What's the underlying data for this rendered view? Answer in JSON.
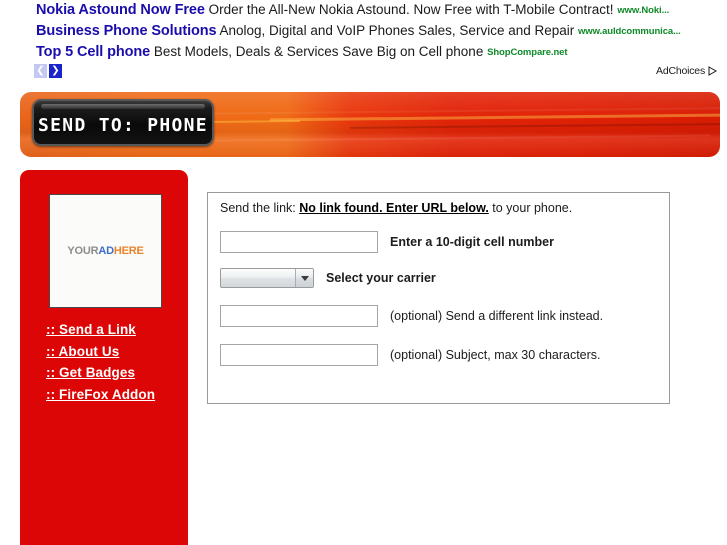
{
  "ads": {
    "rows": [
      {
        "title": "Nokia Astound Now Free",
        "desc": "Order the All-New Nokia Astound. Now Free with T-Mobile Contract!",
        "url": "www.Noki..."
      },
      {
        "title": "Business Phone Solutions",
        "desc": "Anolog, Digital and VoIP Phones Sales, Service and Repair",
        "url": "www.auldcommunica..."
      },
      {
        "title": "Top 5 Cell phone",
        "desc": "Best Models, Deals & Services Save Big on Cell phone",
        "url": "ShopCompare.net"
      }
    ],
    "pager": {
      "prev_label": "❮",
      "prev_icon": "chevron-left-icon",
      "next_label": "❯",
      "next_icon": "chevron-right-icon"
    },
    "adchoices_label": "AdChoices",
    "adchoices_icon": "adchoices-triangle-icon",
    "title_color": "#1a0dab",
    "url_color": "#0f8a28"
  },
  "banner": {
    "logo_text": "SEND TO: PHONE",
    "gradient_start": "#e8641a",
    "gradient_end": "#d81c04"
  },
  "sidebar": {
    "background_color": "#dd0606",
    "ad_placeholder": {
      "name": "your-ad-here",
      "word1": "YOUR",
      "word2": "AD",
      "word3": "HERE",
      "word1_color": "#8d8d8d",
      "word2_color": "#3f6fcb",
      "word3_color": "#e8832a"
    },
    "links": [
      {
        "label": ":: Send a Link",
        "name": "send-a-link"
      },
      {
        "label": ":: About Us",
        "name": "about-us"
      },
      {
        "label": ":: Get Badges",
        "name": "get-badges"
      },
      {
        "label": ":: FireFox Addon",
        "name": "firefox-addon"
      }
    ]
  },
  "form": {
    "intro_prefix": "Send the link: ",
    "intro_link_status": "No link found. Enter URL below.",
    "intro_suffix": " to your phone.",
    "cell_number": {
      "value": "",
      "placeholder": "",
      "label": "Enter a 10-digit cell number"
    },
    "carrier": {
      "selected": "",
      "label": "Select your carrier"
    },
    "alt_link": {
      "value": "",
      "placeholder": "",
      "label": "(optional) Send a different link instead."
    },
    "subject": {
      "value": "",
      "placeholder": "",
      "label": "(optional) Subject, max 30 characters."
    }
  }
}
